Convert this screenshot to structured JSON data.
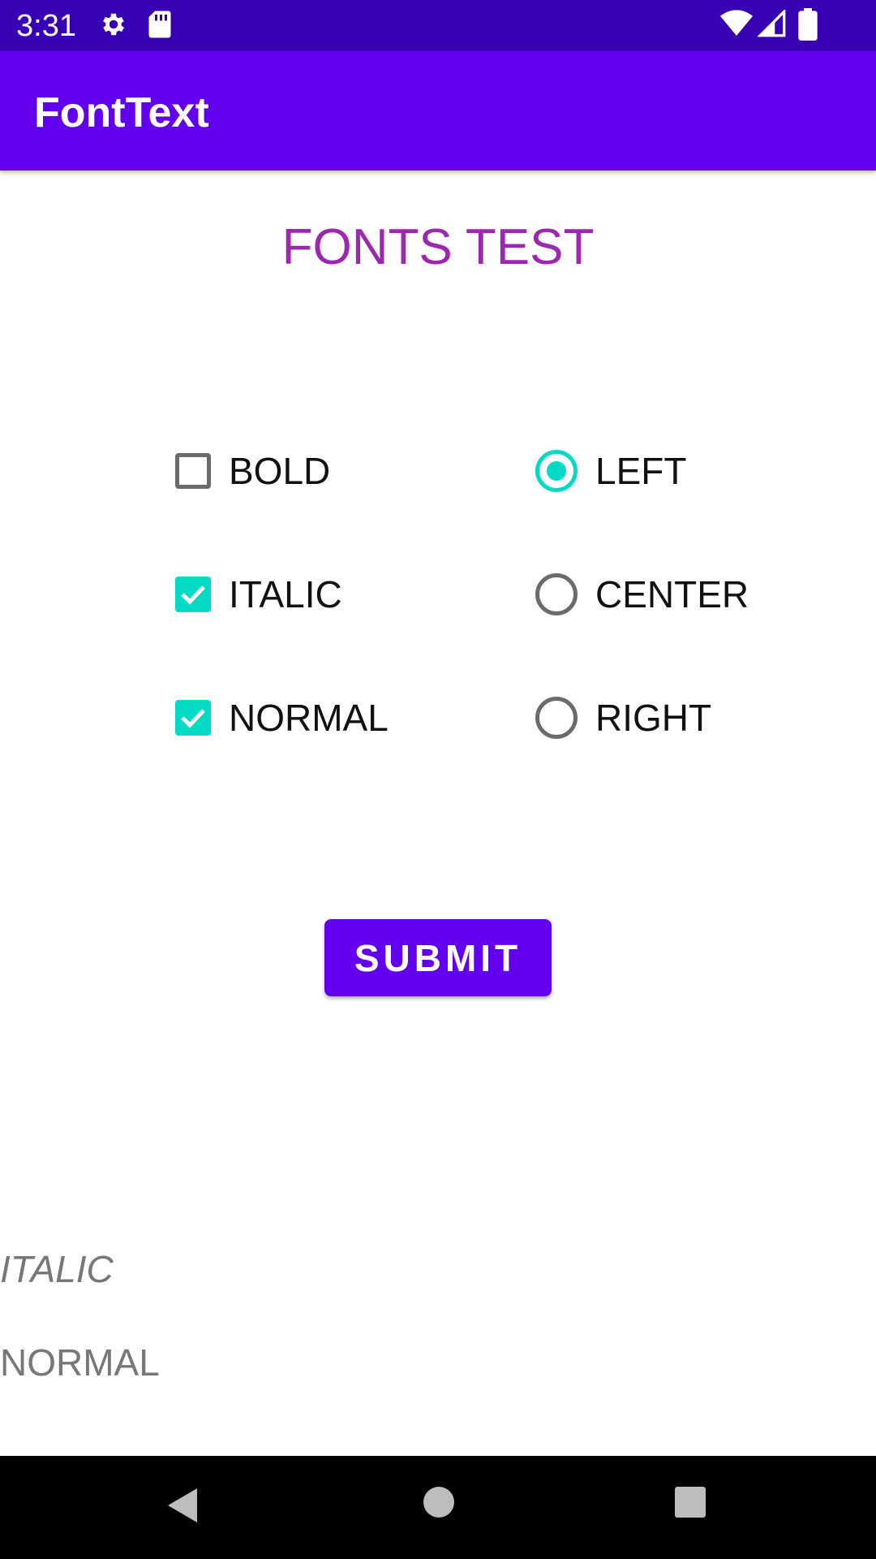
{
  "status_bar": {
    "time": "3:31",
    "icons": [
      "gear-icon",
      "sd-card-icon",
      "wifi-icon",
      "signal-icon",
      "battery-icon"
    ]
  },
  "app_bar": {
    "title": "FontText",
    "color": "#6200EE"
  },
  "main": {
    "heading": "FONTS TEST",
    "checkboxes": [
      {
        "label": "BOLD",
        "checked": false
      },
      {
        "label": "ITALIC",
        "checked": true
      },
      {
        "label": "NORMAL",
        "checked": true
      }
    ],
    "radios": [
      {
        "label": "LEFT",
        "selected": true
      },
      {
        "label": "CENTER",
        "selected": false
      },
      {
        "label": "RIGHT",
        "selected": false
      }
    ],
    "submit_label": "SUBMIT",
    "output": {
      "italic": "ITALIC",
      "normal": "NORMAL"
    }
  },
  "colors": {
    "status_bar": "#3700B3",
    "primary": "#6200EE",
    "accent": "#03DAC5",
    "heading": "#9C27B0"
  },
  "nav_bar": {
    "icons": [
      "back-icon",
      "home-icon",
      "recents-icon"
    ]
  }
}
